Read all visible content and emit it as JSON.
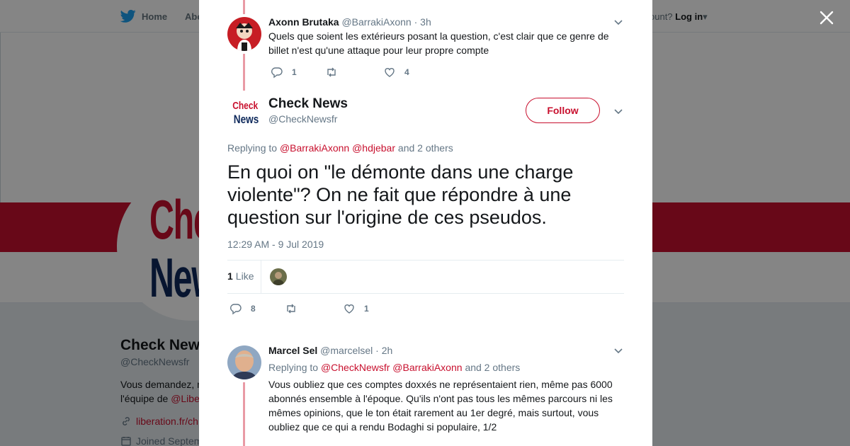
{
  "nav": {
    "home": "Home",
    "about": "Abo",
    "account_prompt": "ccount?",
    "login": "Log in"
  },
  "profile": {
    "logo_line1": "Chec",
    "logo_line2": "New",
    "name": "Check News",
    "handle": "@CheckNewsfr",
    "bio_line1": "Vous demandez, n",
    "bio_line2_prefix": "l'équipe de ",
    "bio_line2_mention": "@Libe",
    "link": "liberation.fr/ch",
    "joined": "Joined Septem"
  },
  "tweets": {
    "t1": {
      "name": "Axonn Brutaka",
      "handle": "@BarrakiAxonn",
      "time": "· 3h",
      "text": "Quels que soient les extérieurs posant la question, c'est clair que ce genre de billet n'est qu'une attaque pour leur propre compte",
      "replies": "1",
      "retweets": "",
      "likes": "4"
    },
    "main": {
      "name": "Check News",
      "handle": "@CheckNewsfr",
      "follow_label": "Follow",
      "replying_prefix": "Replying to",
      "mention1": "@BarrakiAxonn",
      "mention2": "@hdjebar",
      "replying_suffix": "and 2 others",
      "text": "En quoi on \"le démonte dans une charge violente\"? On ne fait que répondre à une question sur l'origine de ces pseudos.",
      "timestamp": "12:29 AM - 9 Jul 2019",
      "like_count": "1",
      "like_label": "Like",
      "replies": "8",
      "retweets": "",
      "likes": "1"
    },
    "t3": {
      "name": "Marcel Sel",
      "handle": "@marcelsel",
      "time": "· 2h",
      "replying_prefix": "Replying to",
      "mention1": "@CheckNewsfr",
      "mention2": "@BarrakiAxonn",
      "replying_suffix": "and 2 others",
      "text": "Vous oubliez que ces comptes doxxés ne représentaient rien, même pas 6000 abonnés ensemble à l'époque. Qu'ils n'ont pas tous les mêmes parcours ni les mêmes opinions, que le ton était rarement au 1er degré,  mais surtout, vous oubliez que ce qui a rendu Bodaghi si populaire, 1/2"
    }
  },
  "icons": {
    "logo": "twitter-bird-icon",
    "close": "close-icon",
    "reply": "reply-icon",
    "retweet": "retweet-icon",
    "like": "heart-icon",
    "more": "chevron-down-icon",
    "link": "link-icon",
    "calendar": "calendar-icon"
  },
  "colors": {
    "accent": "#c8102e",
    "thread_line": "#e99aa5",
    "muted": "#657786"
  }
}
